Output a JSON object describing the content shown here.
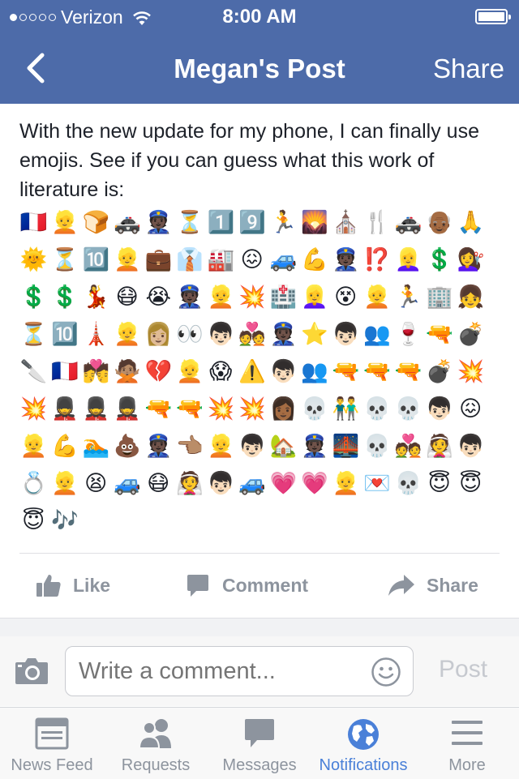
{
  "status_bar": {
    "carrier": "Verizon",
    "time": "8:00 AM"
  },
  "nav": {
    "title": "Megan's Post",
    "share_label": "Share"
  },
  "post": {
    "text": "With the new update for my phone, I can finally use emojis. See if you can guess what this work of literature is:",
    "emojis": [
      "🇫🇷",
      "👱",
      "🍞",
      "🚓",
      "👮🏿",
      "⏳",
      "1️⃣",
      "9️⃣",
      "🏃",
      "🌄",
      "⛪",
      "🍴",
      "🚓",
      "👴🏾",
      "🙏",
      "🌞",
      "⏳",
      "🔟",
      "👱",
      "💼",
      "👔",
      "🏭",
      "😖",
      "🚙",
      "💪",
      "👮🏿",
      "⁉️",
      "👱‍♀️",
      "💲",
      "💇‍♀️",
      "💲",
      "💲",
      "💃",
      "😷",
      "😭",
      "👮🏿",
      "👱",
      "💥",
      "🏥",
      "👱‍♀️",
      "😵",
      "👱",
      "🏃",
      "🏢",
      "👧",
      "⏳",
      "🔟",
      "🗼",
      "👱",
      "👩🏼",
      "👀",
      "👦🏻",
      "💑",
      "👮🏿",
      "⭐",
      "👦🏻",
      "👥",
      "🍷",
      "🔫",
      "💣",
      "🔪",
      "🇫🇷",
      "💏",
      "🙅🏽",
      "💔",
      "👱",
      "😱",
      "⚠️",
      "👦🏻",
      "👥",
      "🔫",
      "🔫",
      "🔫",
      "💣",
      "💥",
      "💥",
      "💂",
      "💂",
      "💂",
      "🔫",
      "🔫",
      "💥",
      "💥",
      "👩🏾",
      "💀",
      "👬",
      "💀",
      "💀",
      "👦🏻",
      "😖",
      "👱",
      "💪",
      "🏊",
      "💩",
      "👮🏿",
      "👈🏽",
      "👱",
      "👦🏻",
      "🏡",
      "👮🏿",
      "🌉",
      "💀",
      "💑",
      "👰",
      "👦🏻",
      "💍",
      "👱",
      "😫",
      "🚙",
      "😷",
      "👰",
      "👦🏻",
      "🚙",
      "💗",
      "💗",
      "👱",
      "💌",
      "💀",
      "😇",
      "😇",
      "😇",
      "🎶"
    ]
  },
  "actions": {
    "like": "Like",
    "comment": "Comment",
    "share": "Share"
  },
  "composer": {
    "placeholder": "Write a comment...",
    "post_label": "Post"
  },
  "tabs": [
    {
      "label": "News Feed",
      "icon": "news-feed-icon"
    },
    {
      "label": "Requests",
      "icon": "friends-icon"
    },
    {
      "label": "Messages",
      "icon": "chat-bubble-icon"
    },
    {
      "label": "Notifications",
      "icon": "globe-icon",
      "active": true
    },
    {
      "label": "More",
      "icon": "hamburger-menu-icon"
    }
  ],
  "colors": {
    "header": "#4d6ba9",
    "active_tab": "#4a80d8",
    "inactive": "#8d949e"
  }
}
